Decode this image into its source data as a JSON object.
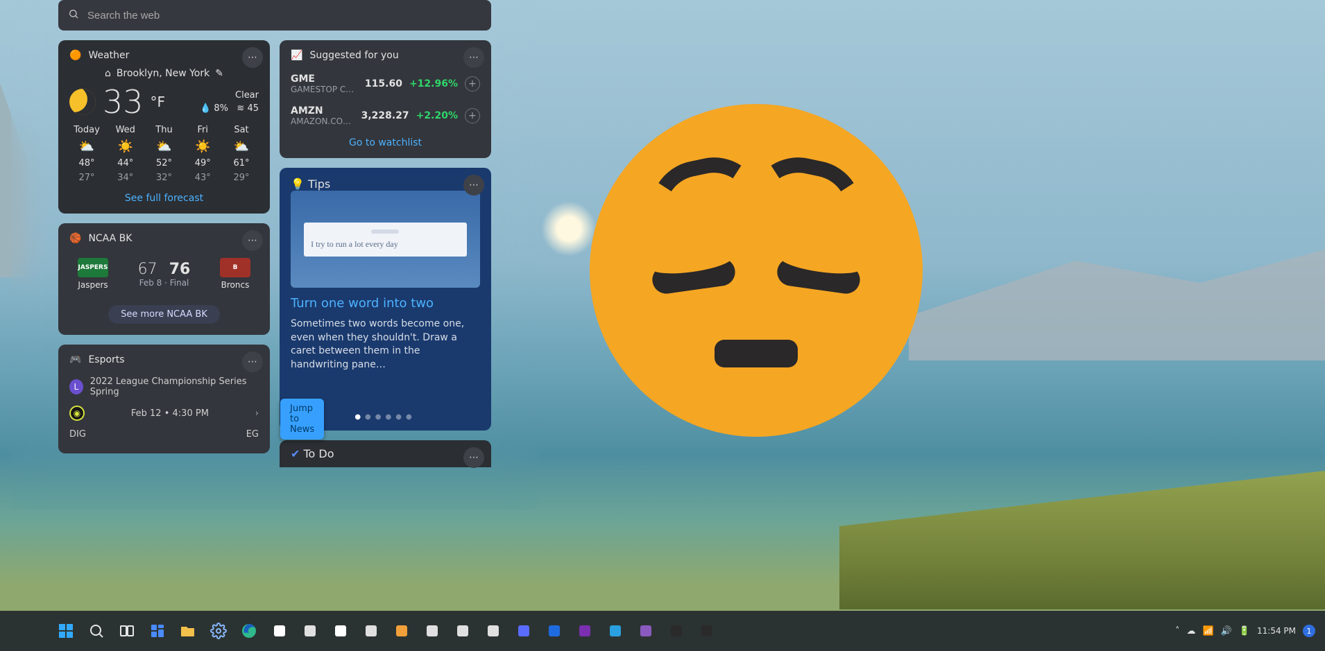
{
  "search": {
    "placeholder": "Search the web"
  },
  "weather": {
    "title": "Weather",
    "location": "Brooklyn, New York",
    "temp": "33",
    "unit": "°F",
    "condition": "Clear",
    "humidity_pct": "8%",
    "aqi": "45",
    "forecast": [
      {
        "day": "Today",
        "icon": "⛅",
        "hi": "48°",
        "lo": "27°"
      },
      {
        "day": "Wed",
        "icon": "☀️",
        "hi": "44°",
        "lo": "34°"
      },
      {
        "day": "Thu",
        "icon": "⛅",
        "hi": "52°",
        "lo": "32°"
      },
      {
        "day": "Fri",
        "icon": "☀️",
        "hi": "49°",
        "lo": "43°"
      },
      {
        "day": "Sat",
        "icon": "⛅",
        "hi": "61°",
        "lo": "29°"
      }
    ],
    "full_link": "See full forecast"
  },
  "suggested": {
    "title": "Suggested for you",
    "stocks": [
      {
        "symbol": "GME",
        "name": "GAMESTOP C…",
        "price": "115.60",
        "pct": "+12.96%"
      },
      {
        "symbol": "AMZN",
        "name": "AMAZON.CO…",
        "price": "3,228.27",
        "pct": "+2.20%"
      }
    ],
    "watchlist_link": "Go to watchlist"
  },
  "ncaa": {
    "title": "NCAA BK",
    "team_a": "Jaspers",
    "team_b": "Broncs",
    "score_a": "67",
    "score_b": "76",
    "status": "Feb 8 · Final",
    "more_link": "See more NCAA BK"
  },
  "esports": {
    "title": "Esports",
    "league": "2022 League Championship Series Spring",
    "date": "Feb 12",
    "time": "4:30 PM",
    "team_a": "DIG",
    "team_b": "EG",
    "jump_label": "Jump to News"
  },
  "tips": {
    "title": "Tips",
    "img_text": "I try to run a lot every day",
    "headline": "Turn one word into two",
    "body": "Sometimes two words become one, even when they shouldn't. Draw a caret between them in the handwriting pane…"
  },
  "todo": {
    "title": "To Do"
  },
  "taskbar": {
    "time": "11:54 PM",
    "date": "",
    "notif_count": "1",
    "apps": [
      {
        "name": "start",
        "color": "#32a9ff"
      },
      {
        "name": "search",
        "color": "#e6e6e6"
      },
      {
        "name": "task-view",
        "color": "#e6e6e6"
      },
      {
        "name": "widgets",
        "color": "#2f7bdc"
      },
      {
        "name": "explorer",
        "color": "#f3c04b"
      },
      {
        "name": "settings",
        "color": "#5aa6ff"
      },
      {
        "name": "edge",
        "color": "#2fb98c"
      },
      {
        "name": "store",
        "color": "#ffffff"
      },
      {
        "name": "slack",
        "color": "#e0e0e0"
      },
      {
        "name": "notion",
        "color": "#ffffff"
      },
      {
        "name": "app-x",
        "color": "#e0e0e0"
      },
      {
        "name": "spotify",
        "color": "#f2a03a"
      },
      {
        "name": "word",
        "color": "#e0e0e0"
      },
      {
        "name": "app-circle",
        "color": "#e0e0e0"
      },
      {
        "name": "app-circle2",
        "color": "#e0e0e0"
      },
      {
        "name": "messenger",
        "color": "#5a6bff"
      },
      {
        "name": "app-blue",
        "color": "#1e6be0"
      },
      {
        "name": "onenote",
        "color": "#7b2fb0"
      },
      {
        "name": "photoshop",
        "color": "#2aa0e0"
      },
      {
        "name": "premiere",
        "color": "#8a5abf"
      },
      {
        "name": "app-dark",
        "color": "#2a2a2a"
      },
      {
        "name": "app-dark2",
        "color": "#2a2a2a"
      }
    ],
    "tray": [
      "chevron-up-icon",
      "onedrive-icon",
      "wifi-icon",
      "volume-icon",
      "battery-icon"
    ]
  }
}
